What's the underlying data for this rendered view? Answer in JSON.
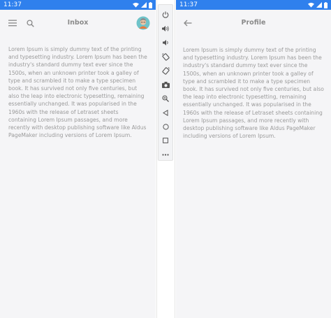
{
  "left_phone": {
    "status_time": "11:37",
    "title": "Inbox",
    "body": "Lorem Ipsum is simply dummy text of the printing and typesetting industry. Lorem Ipsum has been the industry's standard dummy text ever since the 1500s, when an unknown printer took a galley of type and scrambled it to make a type specimen book. It has survived not only five centuries, but also the leap into electronic typesetting, remaining essentially unchanged. It was popularised in the 1960s with the release of Letraset sheets containing Lorem Ipsum passages, and more recently with desktop publishing software like Aldus PageMaker including versions of Lorem Ipsum."
  },
  "right_phone": {
    "status_time": "11:37",
    "title": "Profile",
    "body": "Lorem Ipsum is simply dummy text of the printing and typesetting industry. Lorem Ipsum has been the industry's standard dummy text ever since the 1500s, when an unknown printer took a galley of type and scrambled it to make a type specimen book. It has survived not only five centuries, but also the leap into electronic typesetting, remaining essentially unchanged. It was popularised in the 1960s with the release of Letraset sheets containing Lorem Ipsum passages, and more recently with desktop publishing software like Aldus PageMaker including versions of Lorem Ipsum."
  },
  "emulator_toolbar": {
    "icons": [
      "power-icon",
      "volume-up-icon",
      "volume-down-icon",
      "rotate-left-icon",
      "rotate-right-icon",
      "camera-icon",
      "zoom-icon",
      "back-icon",
      "home-icon",
      "overview-icon",
      "more-icon"
    ]
  },
  "colors": {
    "status_bar": "#2f80ed",
    "background": "#f5f5f7",
    "text": "#9a9a9a",
    "title": "#8a8a8a"
  }
}
